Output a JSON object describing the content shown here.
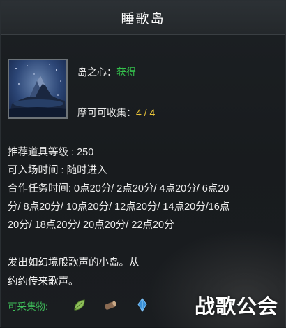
{
  "title": "睡歌岛",
  "item": {
    "heart_label": "岛之心：",
    "heart_value": "获得",
    "moko_label": "摩可可收集：",
    "moko_value": "4 / 4"
  },
  "stats": {
    "level": "推荐道具等级 : 250",
    "entry": "可入场时间 : 随时进入",
    "coop_line1": "合作任务时间:  0点20分/ 2点20分/ 4点20分/ 6点20",
    "coop_line2": "分/ 8点20分/ 10点20分/ 12点20分/ 14点20分/16点",
    "coop_line3": "20分/ 18点20分/ 20点20分/ 22点20分"
  },
  "description": {
    "line1": "发出如幻境般歌声的小岛。从",
    "line2": "约约传来歌声。"
  },
  "gather": {
    "label": "可采集物:",
    "icons": [
      "leaf-icon",
      "log-icon",
      "crystal-icon"
    ]
  },
  "watermark": "战歌公会",
  "colors": {
    "green": "#34c24c",
    "yellow": "#e8c33a",
    "gather_green": "#3fbf5a"
  }
}
